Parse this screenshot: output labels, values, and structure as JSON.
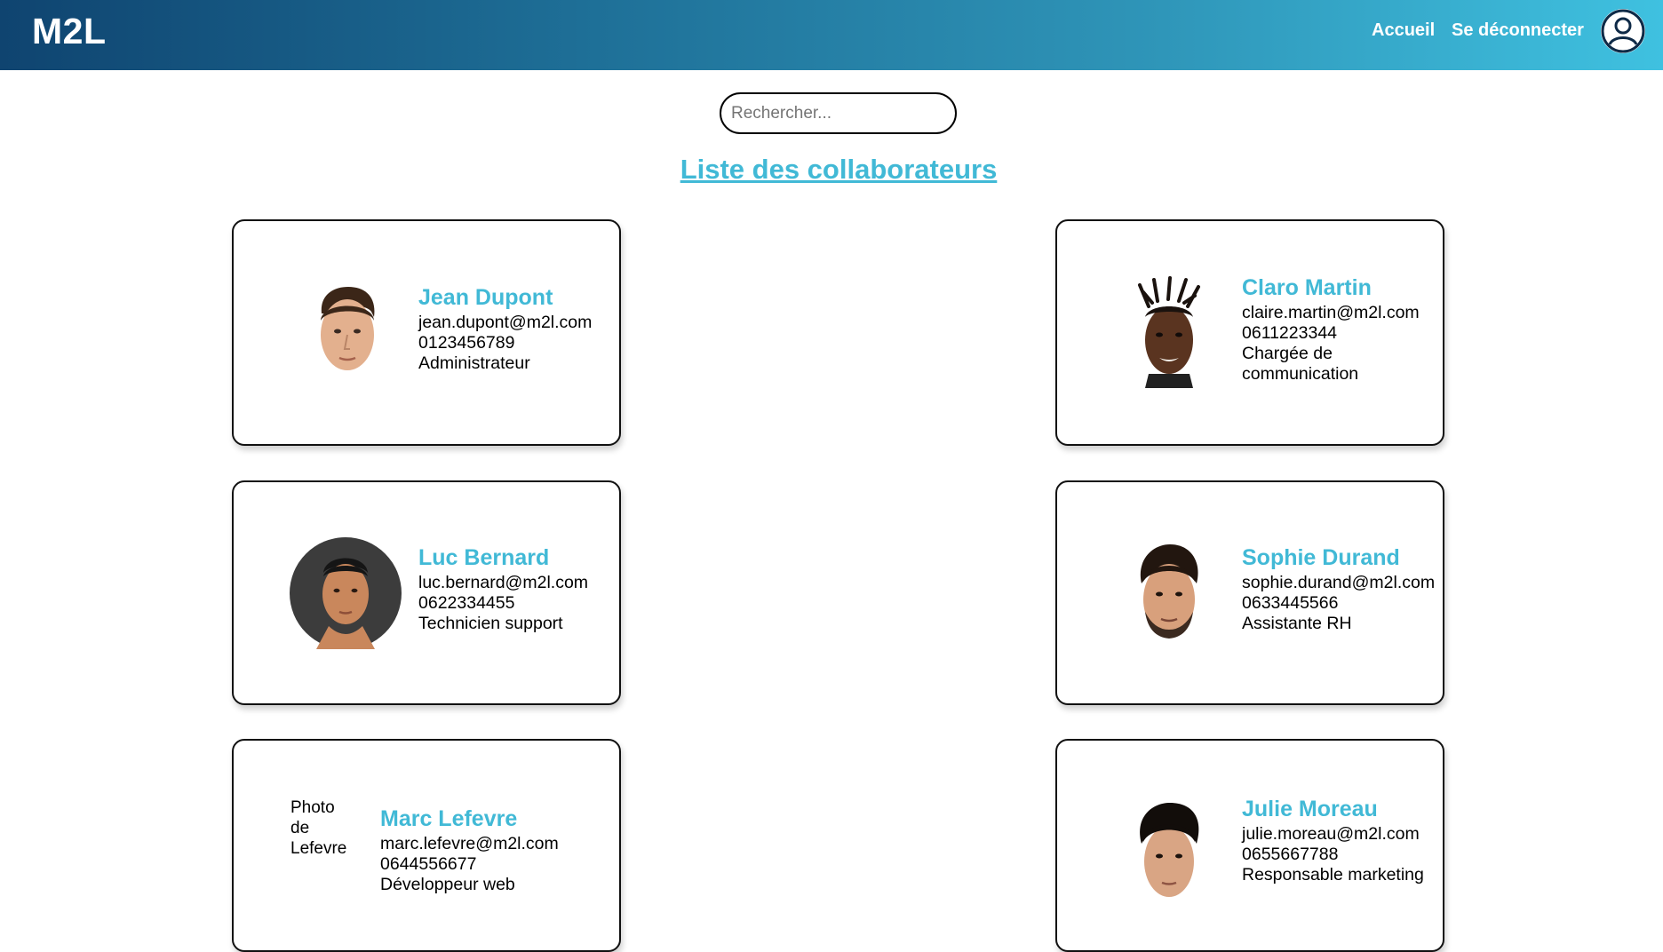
{
  "header": {
    "brand": "M2L",
    "nav": {
      "home": "Accueil",
      "logout": "Se déconnecter"
    },
    "user_icon": "user-circle-icon",
    "gradient": [
      "#0f4470",
      "#3fc1e0"
    ]
  },
  "search": {
    "placeholder": "Rechercher...",
    "value": ""
  },
  "page_title": "Liste des collaborateurs",
  "accent_color": "#41b9d6",
  "collaborators": [
    {
      "name": "Jean Dupont",
      "email": "jean.dupont@m2l.com",
      "phone": "0123456789",
      "role": "Administrateur"
    },
    {
      "name": "Claro Martin",
      "email": "claire.martin@m2l.com",
      "phone": "0611223344",
      "role": "Chargée de communication"
    },
    {
      "name": "Luc Bernard",
      "email": "luc.bernard@m2l.com",
      "phone": "0622334455",
      "role": "Technicien support"
    },
    {
      "name": "Sophie Durand",
      "email": "sophie.durand@m2l.com",
      "phone": "0633445566",
      "role": "Assistante RH"
    },
    {
      "name": "Marc Lefevre",
      "email": "marc.lefevre@m2l.com",
      "phone": "0644556677",
      "role": "Développeur web",
      "photo_alt": "Photo de Lefevre"
    },
    {
      "name": "Julie Moreau",
      "email": "julie.moreau@m2l.com",
      "phone": "0655667788",
      "role": "Responsable marketing"
    }
  ]
}
